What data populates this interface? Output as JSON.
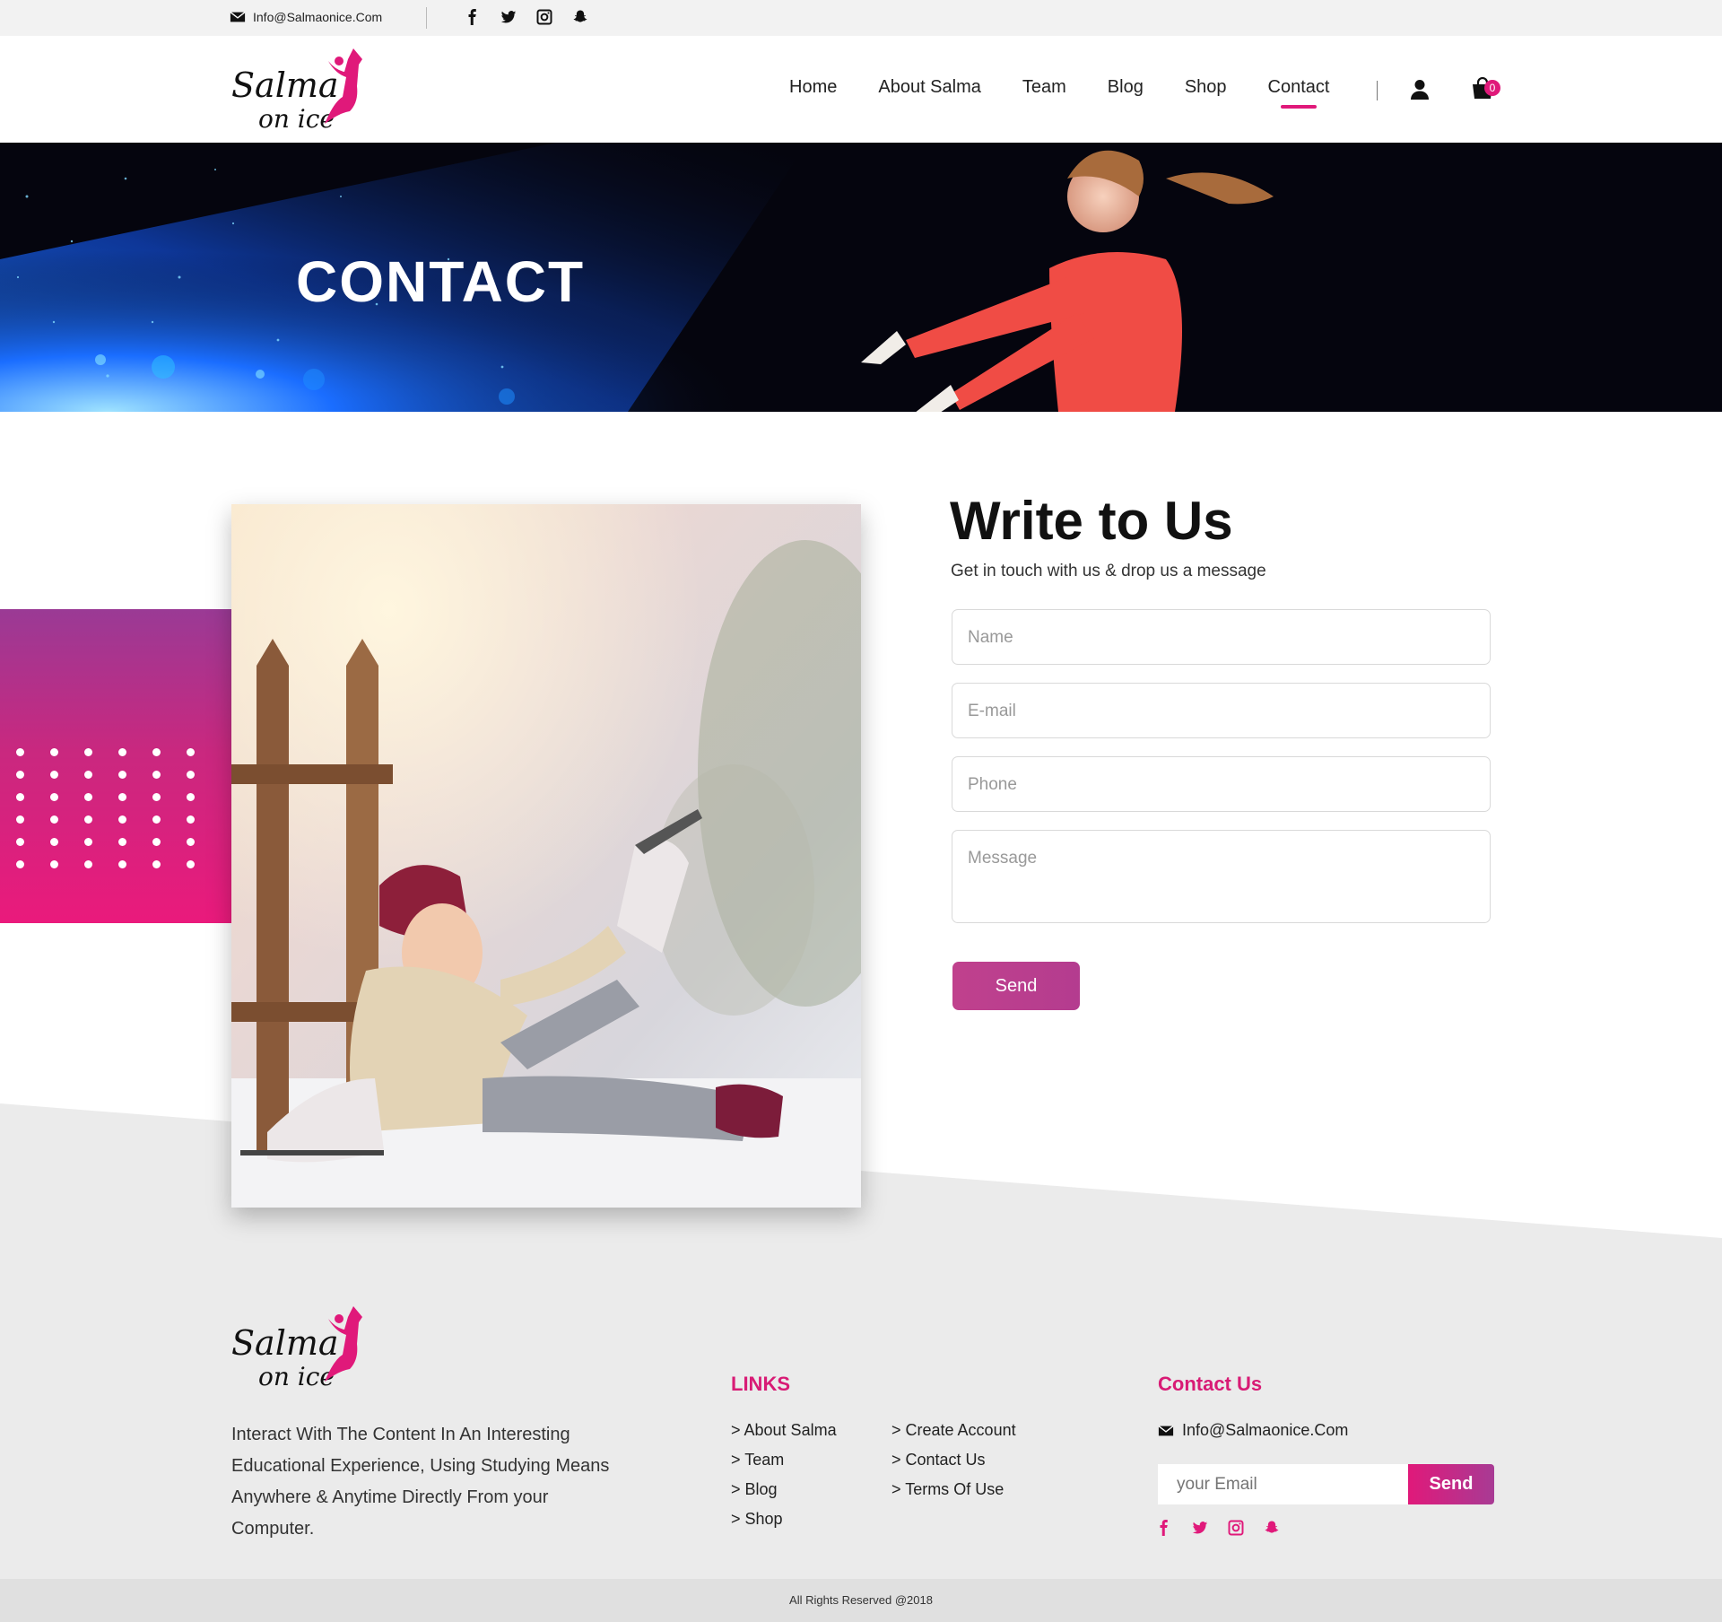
{
  "topbar": {
    "email": "Info@Salmaonice.Com",
    "socials": [
      "facebook-icon",
      "twitter-icon",
      "instagram-icon",
      "snapchat-icon"
    ]
  },
  "brand": {
    "line1": "Salma",
    "line2": "on ice",
    "accent": "#e0197a"
  },
  "nav": {
    "items": [
      {
        "label": "Home"
      },
      {
        "label": "About Salma"
      },
      {
        "label": "Team"
      },
      {
        "label": "Blog"
      },
      {
        "label": "Shop"
      },
      {
        "label": "Contact",
        "active": true
      }
    ],
    "cart_count": "0"
  },
  "hero": {
    "title": "CONTACT"
  },
  "form": {
    "title": "Write to Us",
    "subtitle": "Get in touch with us & drop us a message",
    "name_placeholder": "Name",
    "email_placeholder": "E-mail",
    "phone_placeholder": "Phone",
    "message_placeholder": "Message",
    "send_label": "Send"
  },
  "footer": {
    "description": "Interact With The Content In An Interesting Educational Experience, Using Studying Means Anywhere & Anytime Directly From your Computer.",
    "links_title": "LINKS",
    "links_col1": [
      ">  About Salma",
      ">  Team",
      ">  Blog",
      ">  Shop"
    ],
    "links_col2": [
      ">  Create Account",
      "> Contact Us",
      ">  Terms Of Use"
    ],
    "contact_title": "Contact Us",
    "contact_email": "Info@Salmaonice.Com",
    "newsletter_placeholder": "your Email",
    "newsletter_button": "Send",
    "copyright": "All Rights Reserved @2018"
  }
}
